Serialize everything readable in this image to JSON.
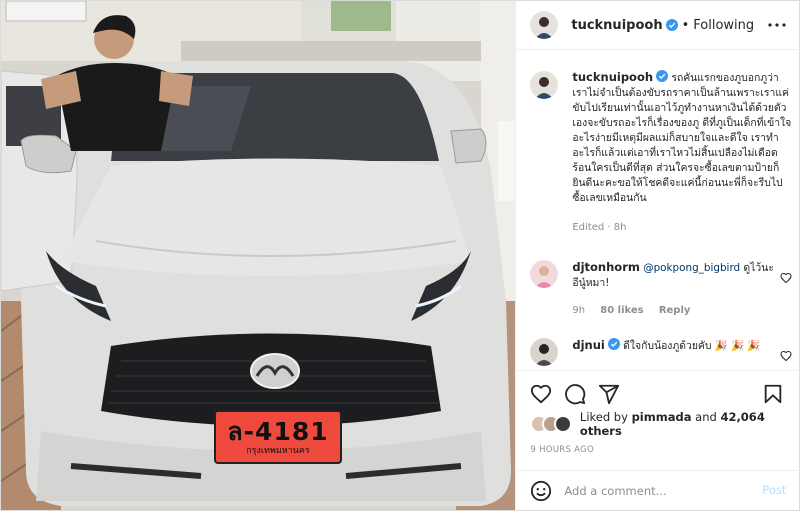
{
  "post": {
    "username": "tucknuipooh",
    "follow_state": "Following",
    "separator": "•",
    "caption": "รถคันแรกของภูบอกภูว่าเราไม่จำเป็นต้องขับรถราคาเป็นล้านเพราะเราแค่ขับไปเรียนเท่านั้นเอาไว้ภูทำงานหาเงินได้ด้วยตัวเองจะขับรถอะไรก็เรื่องของภู ดีที่ภูเป็นเด็กที่เข้าใจอะไรง่ายมีเหตุมีผลแม่ก็สบายใจและดีใจ เราทำอะไรก็แล้วแต่เอาที่เราไหวไม่สิ้นเปลืองไม่เดือดร้อนใครเป็นดีที่สุด ส่วนใครจะซื้อเลขตามป้ายก็ยินดีนะคะขอให้โชคดีจะแค่นี้ก่อนนะพี่ก็จะรีบไปซื้อเลขเหมือนกัน",
    "caption_meta": "Edited · 8h",
    "likes_prefix": "Liked by",
    "liked_by_user": "pimmada",
    "likes_join": "and",
    "likes_count_text": "42,064 others",
    "timestamp": "9 HOURS AGO",
    "plate_number": "ล-4181",
    "plate_province": "กรุงเทพมหานคร"
  },
  "comments": [
    {
      "username": "djtonhorm",
      "mention": "@pokpong_bigbird",
      "text": " ดูไว้นะอีนู๋หมา!",
      "time": "9h",
      "likes": "80 likes",
      "reply_label": "Reply"
    },
    {
      "username": "djnui",
      "mention": "",
      "text": "ดีใจกับน้องภูด้วยคับ 🎉 🎉 🎉"
    }
  ],
  "add_comment": {
    "placeholder": "Add a comment...",
    "post_label": "Post"
  },
  "colors": {
    "verified": "#3897f0",
    "mention": "#00376b",
    "post_disabled": "#b2dffc",
    "plate": "#f04a3f",
    "car": "#dcdcdc"
  },
  "icons": {
    "more": "more-horizontal-icon",
    "like": "heart-icon",
    "comment": "comment-bubble-icon",
    "share": "paper-plane-icon",
    "save": "bookmark-icon",
    "emoji": "smiley-icon",
    "verified": "verified-badge-icon"
  }
}
